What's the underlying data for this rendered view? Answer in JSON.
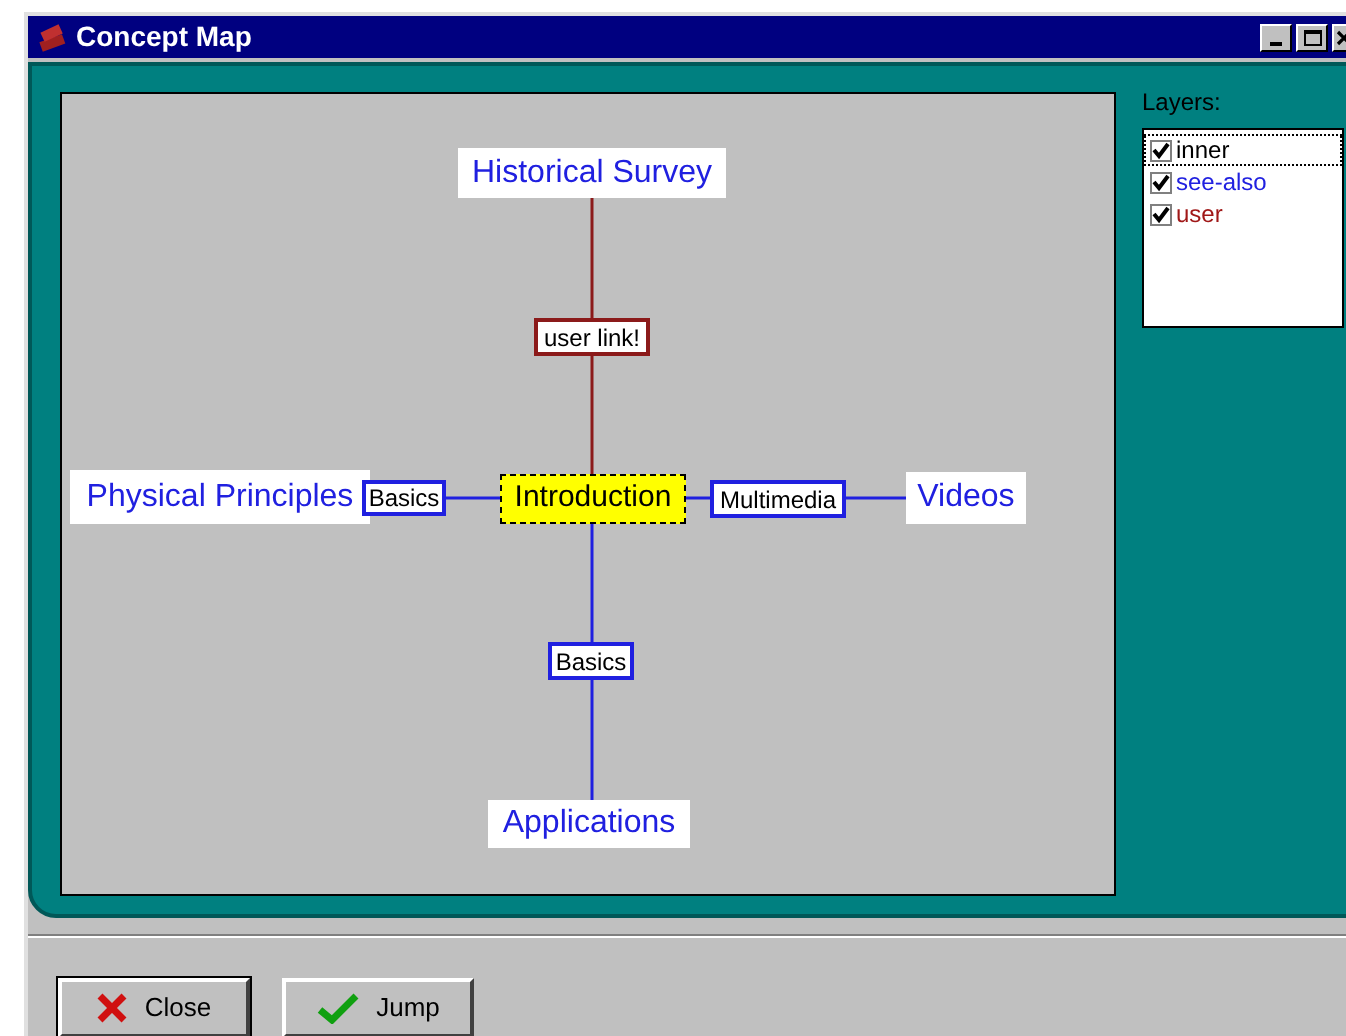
{
  "window": {
    "title": "Concept Map"
  },
  "map": {
    "nodes": [
      {
        "kind": "topic",
        "label": "Historical Survey",
        "color": "#2020e0"
      },
      {
        "kind": "link",
        "label": "user link!",
        "color": "#8b1a1a"
      },
      {
        "kind": "topic",
        "label": "Physical Principles",
        "color": "#2020e0"
      },
      {
        "kind": "link",
        "label": "Basics",
        "color": "#2020e0"
      },
      {
        "kind": "focus",
        "label": "Introduction",
        "color": "#ffff00"
      },
      {
        "kind": "link",
        "label": "Multimedia",
        "color": "#2020e0"
      },
      {
        "kind": "topic",
        "label": "Videos",
        "color": "#2020e0"
      },
      {
        "kind": "link",
        "label": "Basics",
        "color": "#2020e0"
      },
      {
        "kind": "topic",
        "label": "Applications",
        "color": "#2020e0"
      }
    ]
  },
  "layers": {
    "title": "Layers:",
    "items": [
      {
        "label": "inner",
        "checked": true,
        "selected": true,
        "color": "#000000"
      },
      {
        "label": "see-also",
        "checked": true,
        "selected": false,
        "color": "#2020e0"
      },
      {
        "label": "user",
        "checked": true,
        "selected": false,
        "color": "#a01818"
      }
    ]
  },
  "buttons": [
    {
      "kind": "close",
      "label": "Close"
    },
    {
      "kind": "jump",
      "label": "Jump"
    }
  ]
}
